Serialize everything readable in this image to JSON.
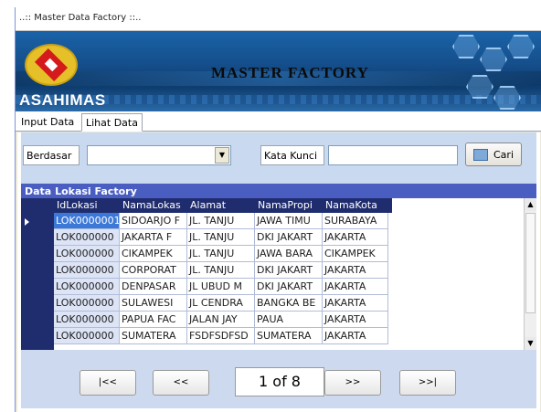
{
  "window": {
    "title": "..:: Master Data Factory ::.."
  },
  "banner": {
    "brand": "ASAHIMAS",
    "title": "MASTER FACTORY"
  },
  "tabs": [
    {
      "label": "Input Data"
    },
    {
      "label": "Lihat Data"
    }
  ],
  "search": {
    "berdasar_label": "Berdasar",
    "berdasar_value": "",
    "kata_kunci_label": "Kata Kunci",
    "kata_kunci_value": "",
    "cari_label": "Cari"
  },
  "grid": {
    "title": "Data Lokasi Factory",
    "columns": [
      "IdLokasi",
      "NamaLokas",
      "Alamat",
      "NamaPropi",
      "NamaKota"
    ],
    "rows": [
      [
        "LOK0000001",
        "SIDOARJO F",
        "JL. TANJU",
        "JAWA TIMU",
        "SURABAYA"
      ],
      [
        "LOK000000",
        "JAKARTA F",
        "JL. TANJU",
        "DKI JAKART",
        "JAKARTA"
      ],
      [
        "LOK000000",
        "CIKAMPEK",
        "JL. TANJU",
        "JAWA BARA",
        "CIKAMPEK"
      ],
      [
        "LOK000000",
        "CORPORAT",
        "JL. TANJU",
        "DKI JAKART",
        "JAKARTA"
      ],
      [
        "LOK000000",
        "DENPASAR",
        "JL UBUD M",
        "DKI JAKART",
        "JAKARTA"
      ],
      [
        "LOK000000",
        "SULAWESI",
        "JL CENDRA",
        "BANGKA BE",
        "JAKARTA"
      ],
      [
        "LOK000000",
        "PAPUA FAC",
        "JALAN JAY",
        "PAUA",
        "JAKARTA"
      ],
      [
        "LOK000000",
        "SUMATERA",
        "FSDFSDFSD",
        "SUMATERA",
        "JAKARTA"
      ]
    ]
  },
  "nav": {
    "first": "|<<",
    "prev": "<<",
    "page": "1 of 8",
    "next": ">>",
    "last": ">>|"
  }
}
